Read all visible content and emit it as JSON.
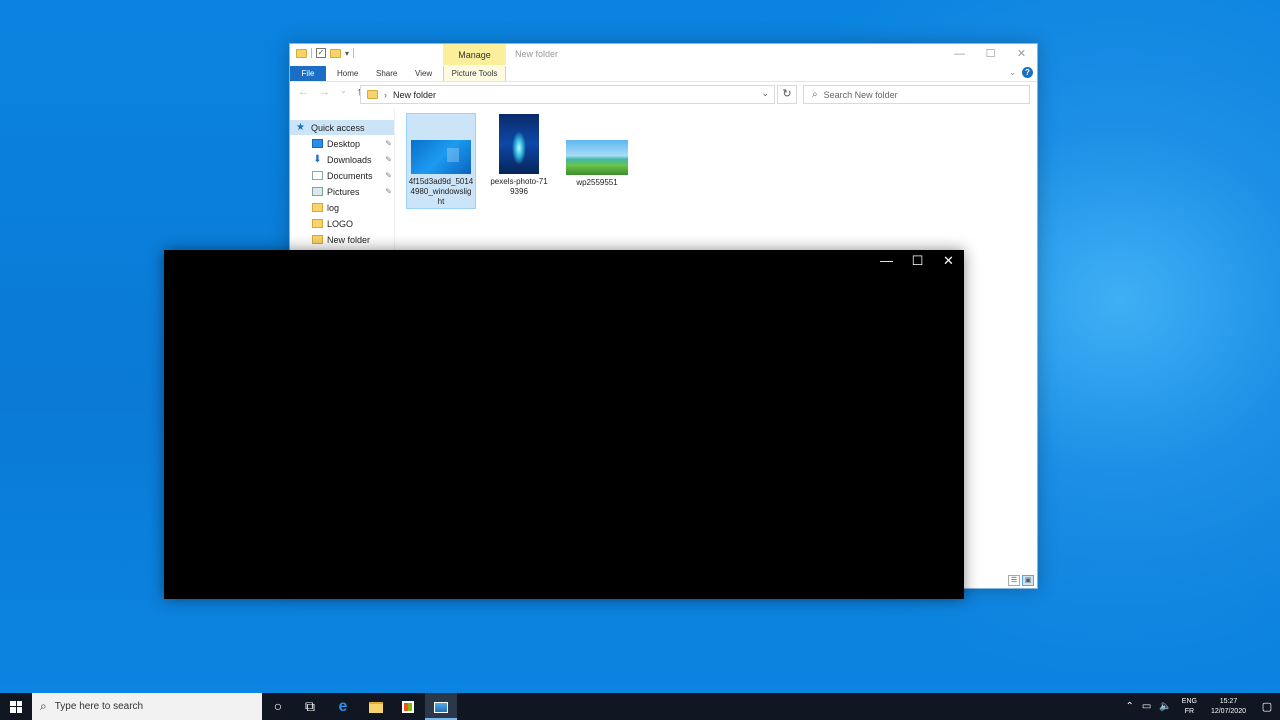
{
  "explorer": {
    "title": "New folder",
    "manage_tab": "Manage",
    "tabs": {
      "file": "File",
      "home": "Home",
      "share": "Share",
      "view": "View",
      "picture_tools": "Picture Tools"
    },
    "address_path": "New folder",
    "search_placeholder": "Search New folder",
    "nav": [
      {
        "label": "Quick access",
        "icon": "star-icon",
        "pinned": false
      },
      {
        "label": "Desktop",
        "icon": "desktop-icon",
        "pinned": true
      },
      {
        "label": "Downloads",
        "icon": "download-icon",
        "pinned": true
      },
      {
        "label": "Documents",
        "icon": "documents-icon",
        "pinned": true
      },
      {
        "label": "Pictures",
        "icon": "pictures-icon",
        "pinned": true
      },
      {
        "label": "log",
        "icon": "folder-icon",
        "pinned": false
      },
      {
        "label": "LOGO",
        "icon": "folder-icon",
        "pinned": false
      },
      {
        "label": "New folder",
        "icon": "folder-icon",
        "pinned": false
      }
    ],
    "files": [
      {
        "name_line1": "4f15d3ad9d_5014",
        "name_line2": "4980_windowslig",
        "name_line3": "ht",
        "selected": true
      },
      {
        "name_line1": "pexels-photo-71",
        "name_line2": "9396",
        "selected": false
      },
      {
        "name_line1": "wp2559551",
        "selected": false
      }
    ]
  },
  "taskbar": {
    "search_placeholder": "Type here to search",
    "lang_top": "ENG",
    "lang_bottom": "FR",
    "time": "15:27",
    "date": "12/07/2020"
  },
  "colors": {
    "desktop": "#0a7ad6",
    "accent": "#1a6fc4",
    "selection": "#cce4f7",
    "manage_tab": "#fbef9b"
  }
}
